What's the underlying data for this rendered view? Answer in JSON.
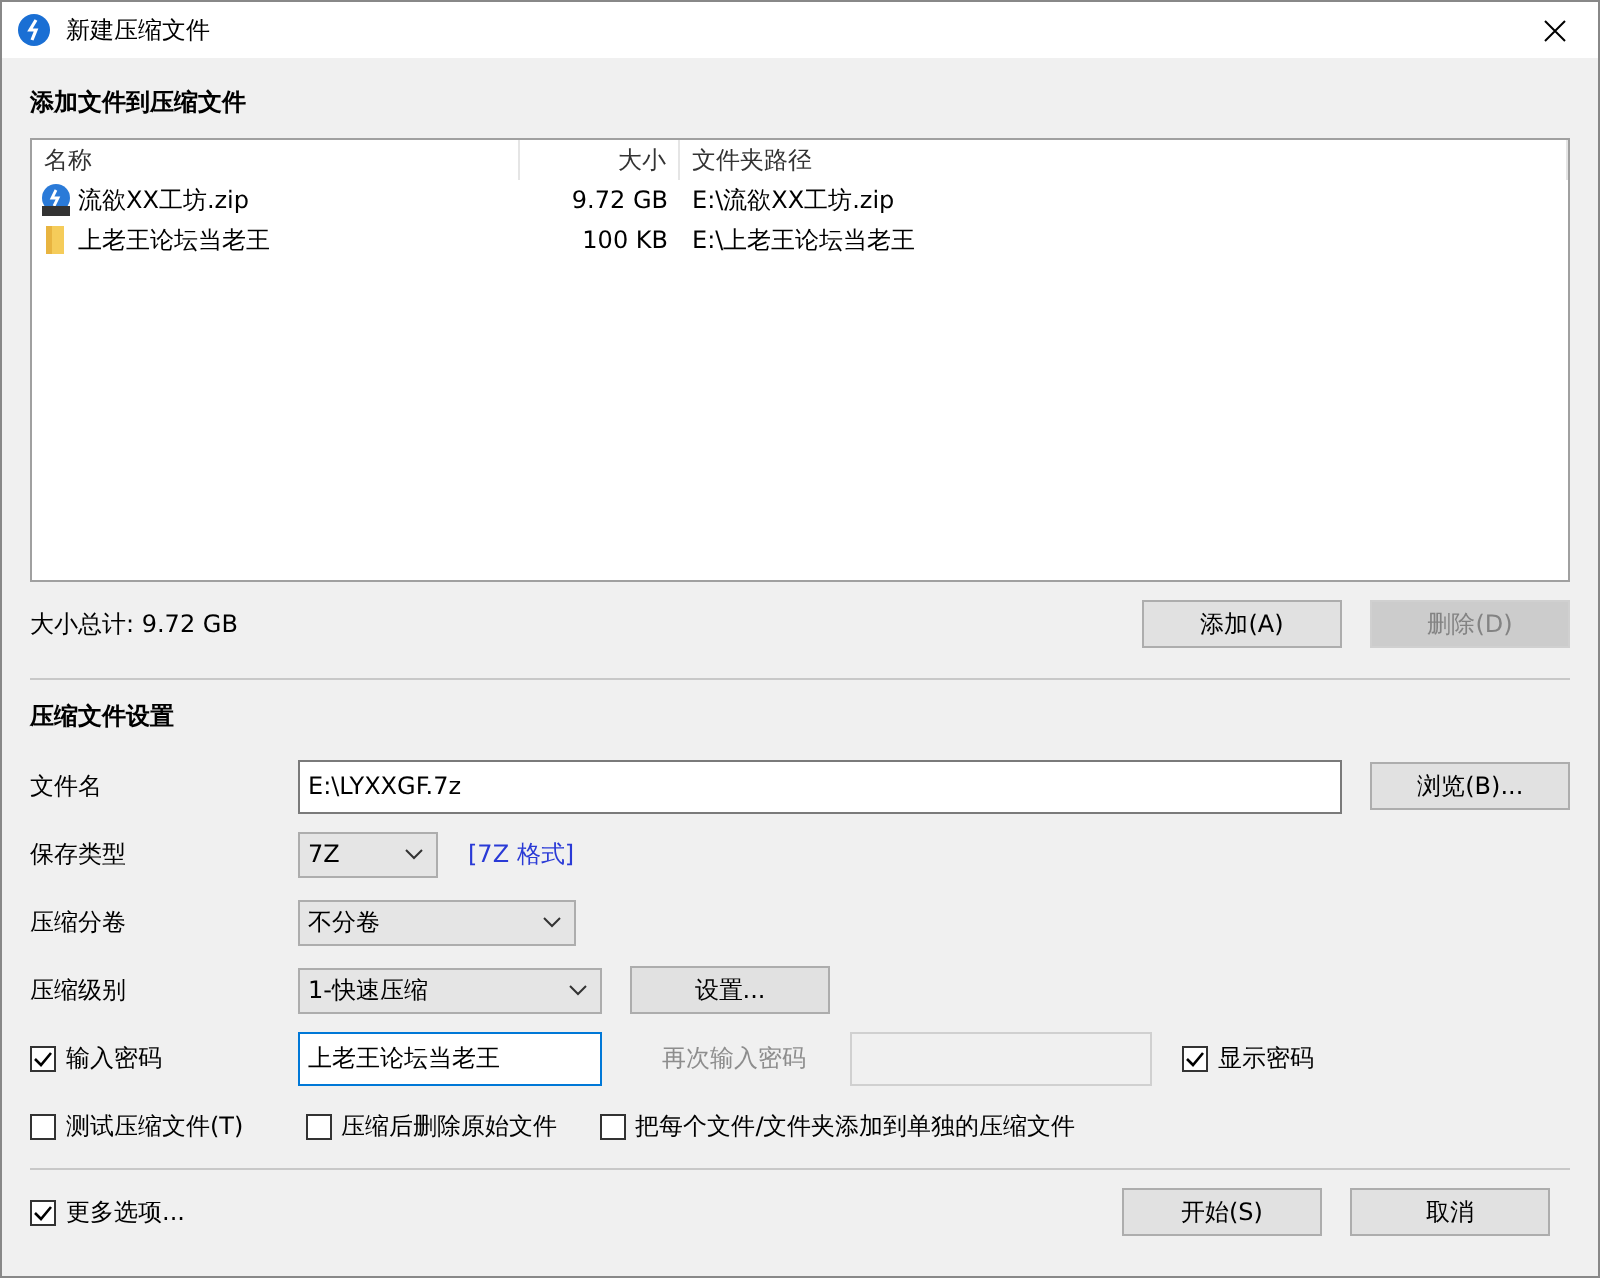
{
  "window": {
    "title": "新建压缩文件"
  },
  "add_section": {
    "title": "添加文件到压缩文件"
  },
  "file_list": {
    "columns": [
      "名称",
      "大小",
      "文件夹路径"
    ],
    "rows": [
      {
        "kind": "zip",
        "name": "流欲XX工坊.zip",
        "size": "9.72 GB",
        "path": "E:\\流欲XX工坊.zip"
      },
      {
        "kind": "folder",
        "name": "上老王论坛当老王",
        "size": "100 KB",
        "path": "E:\\上老王论坛当老王"
      }
    ]
  },
  "total": "大小总计: 9.72 GB",
  "list_buttons": [
    {
      "label": "添加(A)",
      "disabled": false
    },
    {
      "label": "删除(D)",
      "disabled": true
    }
  ],
  "settings": {
    "title": "压缩文件设置",
    "filename": {
      "label": "文件名",
      "value": "E:\\LYXXGF.7z",
      "button": "浏览(B)..."
    },
    "format": {
      "label": "保存类型",
      "value": "7Z",
      "link": "[7Z 格式]"
    },
    "volume": {
      "label": "压缩分卷",
      "value": "不分卷"
    },
    "level": {
      "label": "压缩级别",
      "value": "1-快速压缩",
      "button": "设置..."
    },
    "password": {
      "label": "输入密码",
      "checked": true,
      "value": "上老王论坛当老王",
      "confirm_label": "再次输入密码",
      "confirm_disabled": true,
      "show_label": "显示密码",
      "show_checked": true
    },
    "options": [
      {
        "label": "测试压缩文件(T)",
        "checked": false
      },
      {
        "label": "压缩后删除原始文件",
        "checked": false
      },
      {
        "label": "把每个文件/文件夹添加到单独的压缩文件",
        "checked": false
      }
    ]
  },
  "footer": {
    "more": {
      "label": "更多选项...",
      "checked": true
    },
    "buttons": [
      {
        "label": "开始(S)",
        "disabled": false
      },
      {
        "label": "取消",
        "disabled": false
      }
    ]
  }
}
